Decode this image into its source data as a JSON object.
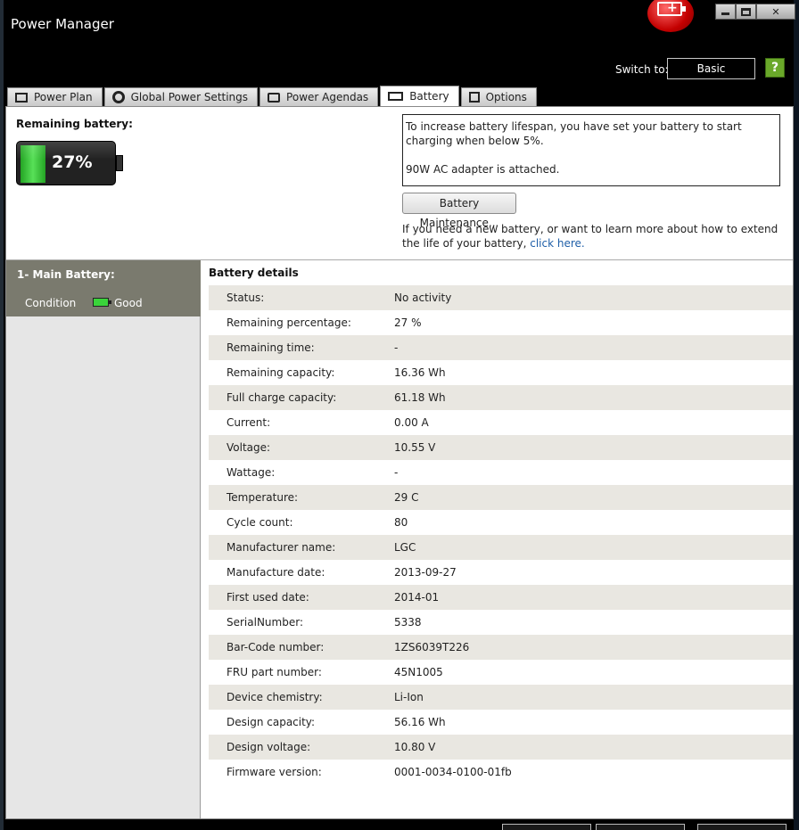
{
  "window": {
    "title": "Power Manager"
  },
  "header": {
    "switch_label": "Switch to:",
    "switch_button": "Basic",
    "help_icon": "?"
  },
  "tabs": [
    {
      "label": "Power Plan",
      "icon": "power-plan-icon"
    },
    {
      "label": "Global Power Settings",
      "icon": "gear-icon"
    },
    {
      "label": "Power Agendas",
      "icon": "agenda-icon"
    },
    {
      "label": "Battery",
      "icon": "battery-icon",
      "active": true
    },
    {
      "label": "Options",
      "icon": "checkbox-icon"
    }
  ],
  "summary": {
    "remaining_label": "Remaining battery:",
    "remaining_percent": "27%",
    "fill_fraction": 0.27,
    "info_line1": "To increase battery lifespan, you have set your battery to start charging when below 5%.",
    "info_line2": "90W AC adapter is attached.",
    "maintenance_button": "Battery Maintenance...",
    "learn_text": "If you need a new battery, or want to learn more about how to extend the life of your battery,",
    "learn_link": "click here."
  },
  "battery_list": {
    "name": "1- Main Battery:",
    "condition_label": "Condition",
    "condition_value": "Good"
  },
  "details": {
    "title": "Battery details",
    "rows": [
      {
        "k": "Status:",
        "v": "No activity"
      },
      {
        "k": "Remaining percentage:",
        "v": "27 %"
      },
      {
        "k": "Remaining time:",
        "v": "-"
      },
      {
        "k": "Remaining capacity:",
        "v": "16.36 Wh"
      },
      {
        "k": "Full charge capacity:",
        "v": "61.18 Wh"
      },
      {
        "k": "Current:",
        "v": "0.00 A"
      },
      {
        "k": "Voltage:",
        "v": "10.55 V"
      },
      {
        "k": "Wattage:",
        "v": "-"
      },
      {
        "k": "Temperature:",
        "v": "29 C"
      },
      {
        "k": "Cycle count:",
        "v": "80"
      },
      {
        "k": "Manufacturer name:",
        "v": "LGC"
      },
      {
        "k": "Manufacture date:",
        "v": "2013-09-27"
      },
      {
        "k": "First used date:",
        "v": "2014-01"
      },
      {
        "k": "SerialNumber:",
        "v": "5338"
      },
      {
        "k": "Bar-Code number:",
        "v": "1ZS6039T226"
      },
      {
        "k": "FRU part number:",
        "v": "45N1005"
      },
      {
        "k": "Device chemistry:",
        "v": "Li-Ion"
      },
      {
        "k": "Design capacity:",
        "v": "56.16 Wh"
      },
      {
        "k": "Design voltage:",
        "v": "10.80 V"
      },
      {
        "k": "Firmware version:",
        "v": "0001-0034-0100-01fb"
      }
    ]
  }
}
